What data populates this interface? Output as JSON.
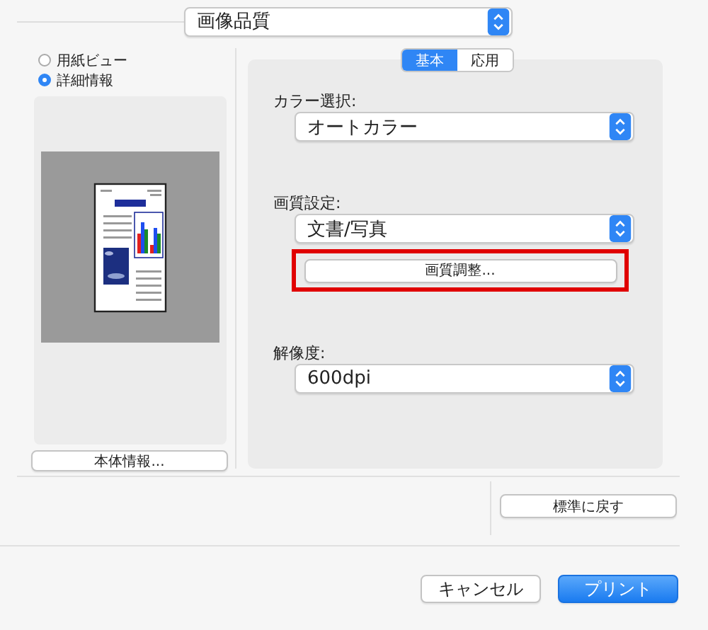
{
  "popup_title": "画像品質",
  "preview_mode": [
    {
      "label": "用紙ビュー",
      "selected": false
    },
    {
      "label": "詳細情報",
      "selected": true
    }
  ],
  "device_info_button": "本体情報...",
  "tabs": [
    {
      "label": "基本",
      "selected": true
    },
    {
      "label": "応用",
      "selected": false
    }
  ],
  "settings": [
    {
      "label": "カラー選択:",
      "value": "オートカラー"
    },
    {
      "label": "画質設定:",
      "value": "文書/写真",
      "button": {
        "label": "画質調整...",
        "highlighted": true
      }
    },
    {
      "label": "解像度:",
      "value": "600dpi"
    }
  ],
  "reset_button": "標準に戻す",
  "buttons": [
    {
      "label": "キャンセル",
      "kind": "cancel"
    },
    {
      "label": "プリント",
      "kind": "default"
    }
  ]
}
